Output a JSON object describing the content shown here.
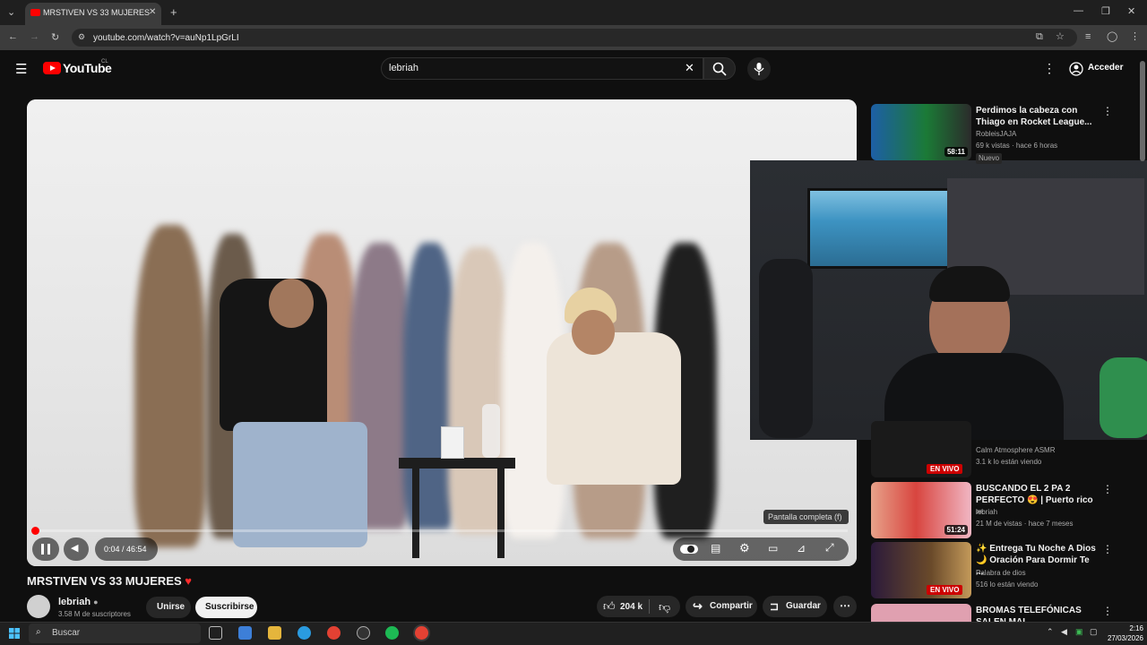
{
  "browser": {
    "tab_title": "MRSTIVEN VS 33 MUJERES",
    "url": "youtube.com/watch?v=auNp1LpGrLI"
  },
  "header": {
    "logo_text": "YouTube",
    "country_code": "CL",
    "search_value": "lebriah",
    "signin_label": "Acceder"
  },
  "player": {
    "time_current": "0:04",
    "time_total": "46:54",
    "time_display": "0:04 / 46:54",
    "progress": 0.0014,
    "tooltip": "Pantalla completa (f)"
  },
  "video": {
    "title": "MRSTIVEN VS 33 MUJERES",
    "channel": "lebriah",
    "subscribers": "3.58 M de suscriptores",
    "join_label": "Unirse",
    "subscribe_label": "Suscribirse",
    "likes": "204 k",
    "share_label": "Compartir",
    "save_label": "Guardar"
  },
  "related": [
    {
      "title": "Perdimos la cabeza con Thiago en Rocket League...",
      "channel": "RobleisJAJA",
      "meta": "69 k vistas · hace 6 horas",
      "badge": "Nuevo",
      "duration": "58:11"
    },
    {
      "title": "",
      "channel": "Calm Atmosphere ASMR",
      "meta": "3.1 k lo están viendo",
      "live": "EN VIVO"
    },
    {
      "title": "BUSCANDO EL 2 PA 2 PERFECTO 😍 | Puerto rico",
      "title_suffix": "PR",
      "channel": "lebriah",
      "meta": "21 M de vistas · hace 7 meses",
      "duration": "51:24"
    },
    {
      "title": "✨ Entrega Tu Noche A Dios 🌙 Oración Para Dormir Te ...",
      "channel": "Palabra de dios",
      "meta": "516 lo están viendo",
      "live": "EN VIVO"
    },
    {
      "title": "BROMAS TELEFÓNICAS SALEN MAL",
      "channel": "",
      "meta": ""
    }
  ],
  "taskbar": {
    "search_label": "Buscar",
    "time": "2:16",
    "date": "27/03/2026"
  },
  "colors": {
    "brand_red": "#ff0000",
    "background": "#0f0f0f",
    "live_red": "#cc0000"
  }
}
